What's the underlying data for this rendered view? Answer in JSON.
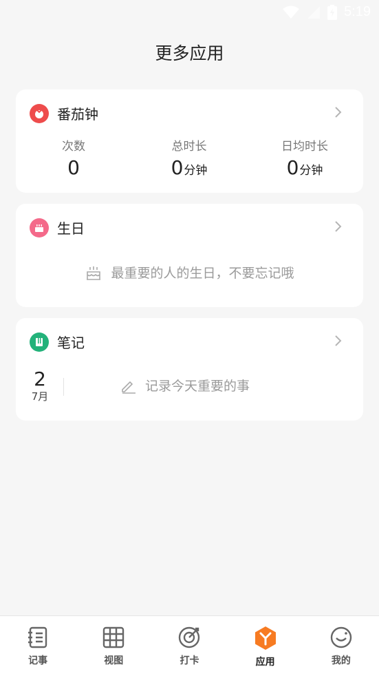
{
  "status": {
    "time": "5:19"
  },
  "page": {
    "title": "更多应用"
  },
  "pomodoro": {
    "title": "番茄钟",
    "stats": [
      {
        "label": "次数",
        "value": "0",
        "unit": ""
      },
      {
        "label": "总时长",
        "value": "0",
        "unit": "分钟"
      },
      {
        "label": "日均时长",
        "value": "0",
        "unit": "分钟"
      }
    ]
  },
  "birthday": {
    "title": "生日",
    "empty_text": "最重要的人的生日，不要忘记哦"
  },
  "notes": {
    "title": "笔记",
    "day": "2",
    "month": "7月",
    "prompt": "记录今天重要的事"
  },
  "tabs": [
    {
      "label": "记事",
      "icon": "notebook-icon"
    },
    {
      "label": "视图",
      "icon": "grid-icon"
    },
    {
      "label": "打卡",
      "icon": "target-icon"
    },
    {
      "label": "应用",
      "icon": "apps-cube-icon"
    },
    {
      "label": "我的",
      "icon": "smile-face-icon"
    }
  ],
  "colors": {
    "accent": "#f77b22",
    "pomodoro": "#ee4c4c",
    "birthday": "#f46a8a",
    "notes": "#23b27a"
  }
}
